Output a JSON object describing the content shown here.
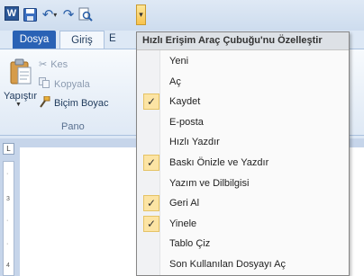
{
  "toolbar": {
    "app_icon_letter": "W",
    "customize_glyph": "▾"
  },
  "ribbon": {
    "tabs": {
      "file": "Dosya",
      "home": "Giriş",
      "next_partial": "E"
    },
    "clipboard": {
      "paste": "Yapıştır",
      "cut": "Kes",
      "copy": "Kopyala",
      "format_painter": "Biçim Boyac",
      "group_label": "Pano"
    }
  },
  "ruler": {
    "corner": "L",
    "marks": [
      "·",
      "3",
      "·",
      "·",
      "4"
    ]
  },
  "menu": {
    "title": "Hızlı Erişim Araç Çubuğu'nu Özelleştir",
    "items": [
      {
        "label": "Yeni",
        "checked": false
      },
      {
        "label": "Aç",
        "checked": false
      },
      {
        "label": "Kaydet",
        "checked": true
      },
      {
        "label": "E-posta",
        "checked": false
      },
      {
        "label": "Hızlı Yazdır",
        "checked": false
      },
      {
        "label": "Baskı Önizle ve Yazdır",
        "checked": true
      },
      {
        "label": "Yazım ve Dilbilgisi",
        "checked": false
      },
      {
        "label": "Geri Al",
        "checked": true
      },
      {
        "label": "Yinele",
        "checked": true
      },
      {
        "label": "Tablo Çiz",
        "checked": false
      },
      {
        "label": "Son Kullanılan Dosyayı Aç",
        "checked": false
      }
    ]
  }
}
